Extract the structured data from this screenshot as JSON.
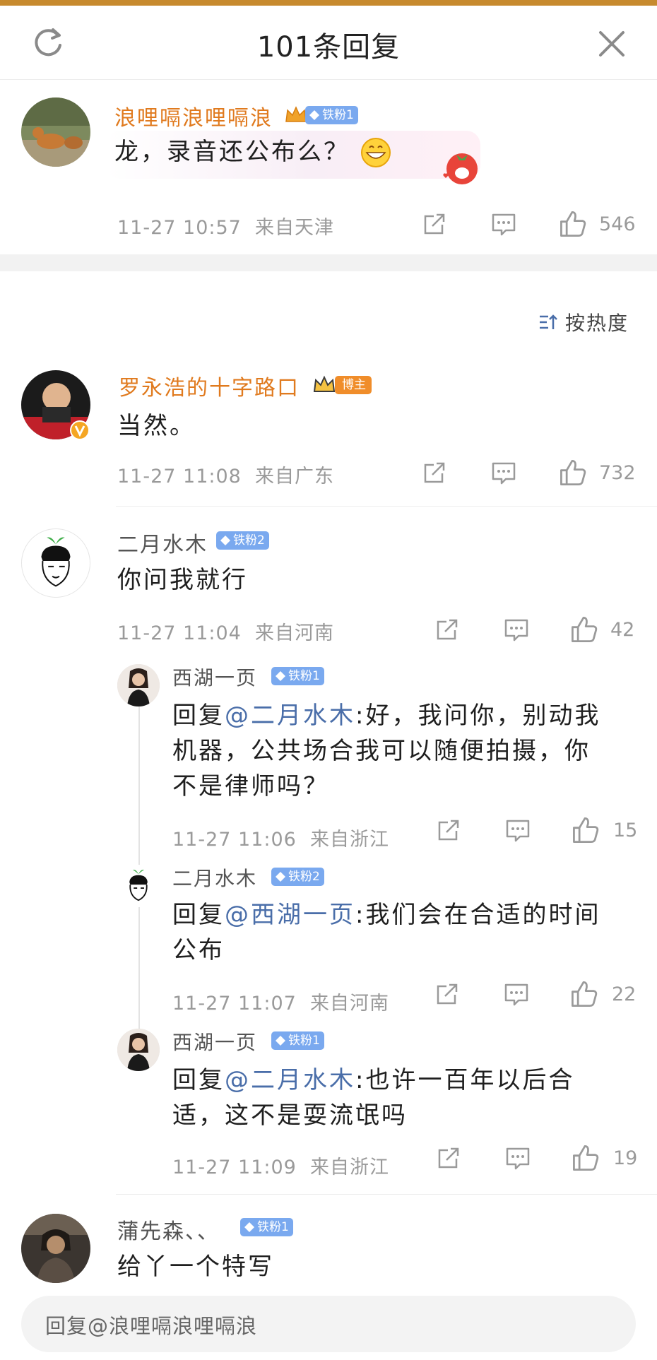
{
  "header": {
    "title": "101条回复"
  },
  "main_comment": {
    "username": "浪哩嗝浪哩嗝浪",
    "badge": "铁粉1",
    "text": "龙，录音还公布么？",
    "time": "11-27 10:57",
    "location": "来自天津",
    "likes": "546"
  },
  "sort": {
    "label": "按热度"
  },
  "replies": [
    {
      "username": "罗永浩的十字路口",
      "badge": "博主",
      "text": "当然。",
      "time": "11-27 11:08",
      "location": "来自广东",
      "likes": "732"
    },
    {
      "username": "二月水木",
      "badge": "铁粉2",
      "text": "你问我就行",
      "time": "11-27 11:04",
      "location": "来自河南",
      "likes": "42",
      "sub": [
        {
          "username": "西湖一页",
          "badge": "铁粉1",
          "prefix": "回复",
          "mention": "@二月水木",
          "lines": [
            ":好，我问你，别动我",
            "机器，公共场合我可以随便拍摄，你",
            "不是律师吗？"
          ],
          "time": "11-27 11:06",
          "location": "来自浙江",
          "likes": "15"
        },
        {
          "username": "二月水木",
          "badge": "铁粉2",
          "prefix": "回复",
          "mention": "@西湖一页",
          "lines": [
            ":我们会在合适的时间",
            "公布"
          ],
          "time": "11-27 11:07",
          "location": "来自河南",
          "likes": "22"
        },
        {
          "username": "西湖一页",
          "badge": "铁粉1",
          "prefix": "回复",
          "mention": "@二月水木",
          "lines": [
            ":也许一百年以后合",
            "适，这不是耍流氓吗"
          ],
          "time": "11-27 11:09",
          "location": "来自浙江",
          "likes": "19"
        }
      ]
    },
    {
      "username": "蒲先森、、",
      "badge": "铁粉1",
      "text": "给丫一个特写"
    }
  ],
  "input": {
    "placeholder": "回复@浪哩嗝浪哩嗝浪"
  },
  "icons": {
    "refresh": "refresh-icon",
    "close": "close-icon",
    "share": "share-icon",
    "comment": "comment-icon",
    "like": "thumbs-up-icon",
    "sort": "sort-icon",
    "crown": "crown-icon",
    "diamond": "diamond-icon"
  },
  "colors": {
    "accent_orange": "#e07a1e",
    "mention_blue": "#4a6ea9",
    "badge_blue": "#7aa9ef",
    "badge_orange": "#f08d2a",
    "meta_gray": "#9a9a9a"
  }
}
